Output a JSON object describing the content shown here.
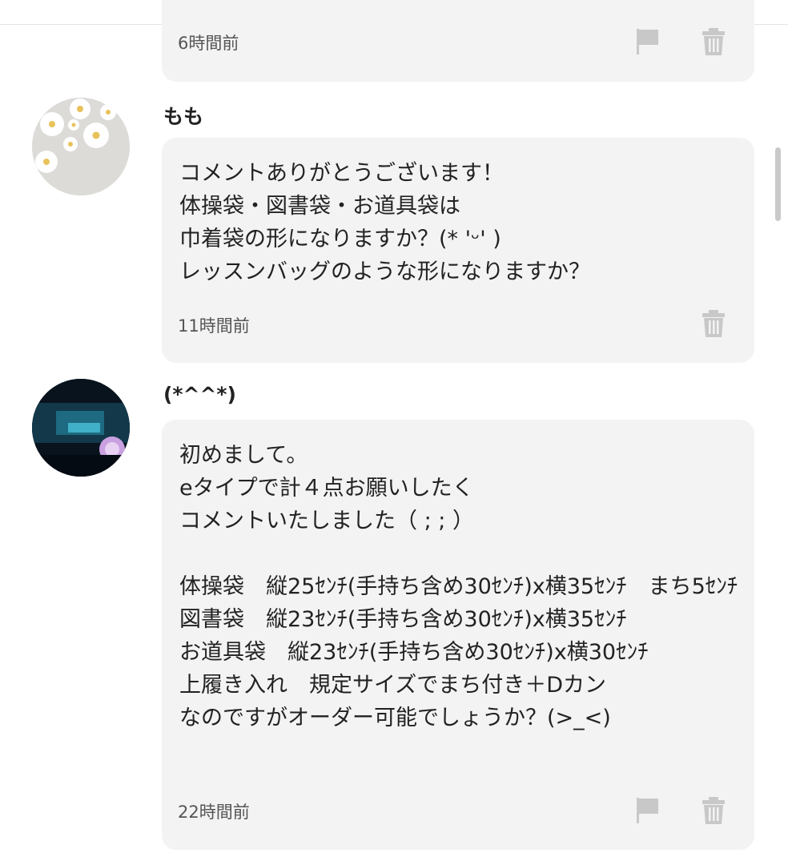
{
  "colors": {
    "bubble_bg": "#f3f3f3",
    "text": "#222222",
    "timestamp": "#555555",
    "icon": "#c8c8c8"
  },
  "comments": [
    {
      "timestamp": "6時間前",
      "icons": [
        "flag-icon",
        "trash-icon"
      ]
    },
    {
      "author": "もも",
      "body": "コメントありがとうございます！\n体操袋・図書袋・お道具袋は\n巾着袋の形になりますか？(* 'ᵕ' )\nレッスンバッグのような形になりますか？",
      "timestamp": "11時間前",
      "icons": [
        "trash-icon"
      ]
    },
    {
      "author": "(*^^*)",
      "body": "初めまして。\neタイプで計４点お願いしたく\nコメントいたしました（ ; ; ）\n\n体操袋　縦25ｾﾝﾁ(手持ち含め30ｾﾝﾁ)x横35ｾﾝﾁ　まち5ｾﾝﾁ\n図書袋　縦23ｾﾝﾁ(手持ち含め30ｾﾝﾁ)x横35ｾﾝﾁ\nお道具袋　縦23ｾﾝﾁ(手持ち含め30ｾﾝﾁ)x横30ｾﾝﾁ\n上履き入れ　規定サイズでまち付き＋Dカン\nなのですがオーダー可能でしょうか？(>_<)",
      "timestamp": "22時間前",
      "icons": [
        "flag-icon",
        "trash-icon"
      ]
    }
  ]
}
